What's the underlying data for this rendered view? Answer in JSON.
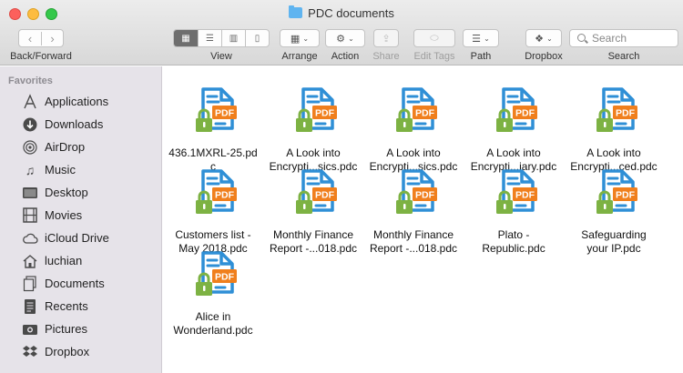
{
  "window": {
    "title": "PDC documents"
  },
  "toolbar": {
    "back_forward_label": "Back/Forward",
    "view_label": "View",
    "arrange_label": "Arrange",
    "action_label": "Action",
    "share_label": "Share",
    "edit_tags_label": "Edit Tags",
    "path_label": "Path",
    "dropbox_label": "Dropbox",
    "search_label": "Search",
    "search_placeholder": "Search",
    "view_modes": [
      "icon",
      "list",
      "column",
      "cover-flow"
    ],
    "active_view": "icon"
  },
  "sidebar": {
    "header": "Favorites",
    "items": [
      {
        "label": "Applications",
        "icon": "applications-icon"
      },
      {
        "label": "Downloads",
        "icon": "downloads-icon"
      },
      {
        "label": "AirDrop",
        "icon": "airdrop-icon"
      },
      {
        "label": "Music",
        "icon": "music-icon"
      },
      {
        "label": "Desktop",
        "icon": "desktop-icon"
      },
      {
        "label": "Movies",
        "icon": "movies-icon"
      },
      {
        "label": "iCloud Drive",
        "icon": "icloud-icon"
      },
      {
        "label": "luchian",
        "icon": "home-icon"
      },
      {
        "label": "Documents",
        "icon": "documents-icon"
      },
      {
        "label": "Recents",
        "icon": "recents-icon"
      },
      {
        "label": "Pictures",
        "icon": "pictures-icon"
      },
      {
        "label": "Dropbox",
        "icon": "dropbox-icon"
      }
    ]
  },
  "files": [
    {
      "line1": "436.1MXRL-25.pd",
      "line2": "c"
    },
    {
      "line1": "A Look into",
      "line2": "Encrypti...sics.pdc"
    },
    {
      "line1": "A Look into",
      "line2": "Encrypti...sics.pdc"
    },
    {
      "line1": "A Look into",
      "line2": "Encrypti...iary.pdc"
    },
    {
      "line1": "A Look into",
      "line2": "Encrypti...ced.pdc"
    },
    {
      "line1": "Customers list -",
      "line2": "May 2018.pdc"
    },
    {
      "line1": "Monthly Finance",
      "line2": "Report -...018.pdc"
    },
    {
      "line1": "Monthly Finance",
      "line2": "Report -...018.pdc"
    },
    {
      "line1": "Plato -",
      "line2": "Republic.pdc"
    },
    {
      "line1": "Safeguarding",
      "line2": "your IP.pdc"
    },
    {
      "line1": "Alice in",
      "line2": "Wonderland.pdc"
    }
  ],
  "file_icon": {
    "badge_text": "PDF",
    "colors": {
      "doc_blue": "#2f8fd6",
      "pdf_orange": "#f07f1d",
      "lock_green": "#7db243"
    }
  },
  "colors": {
    "sidebar_bg": "#e6e3e9",
    "toolbar_bg": "#dcdcdc",
    "accent_blue": "#2f8fd6"
  }
}
